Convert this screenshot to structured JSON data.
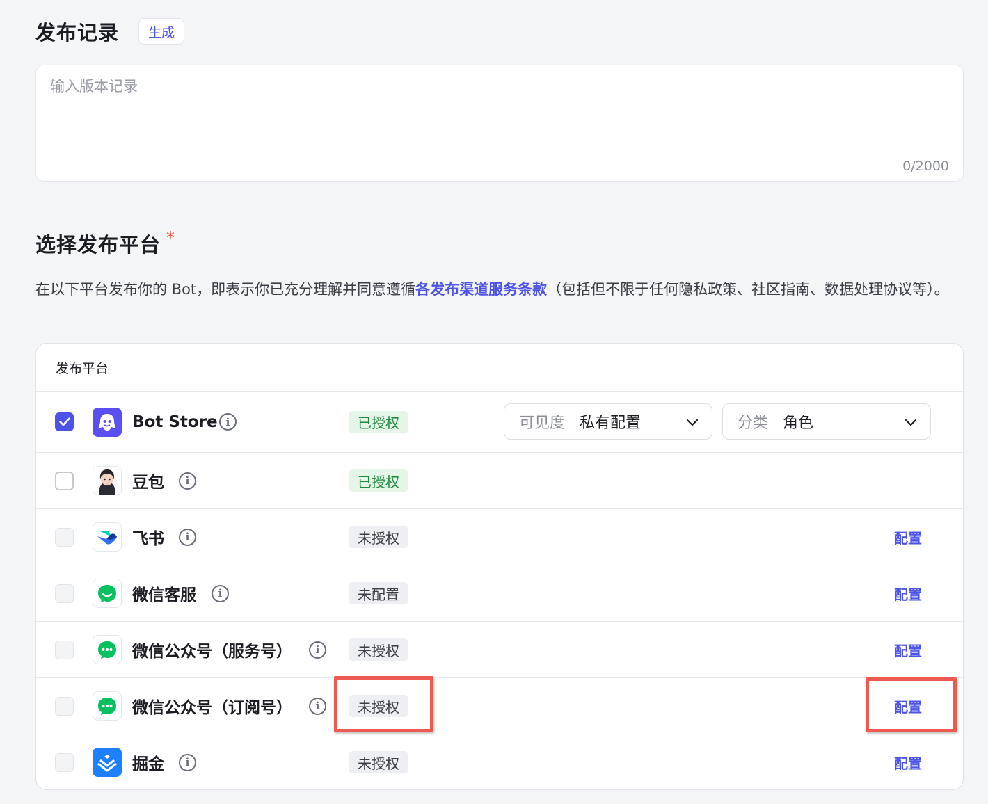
{
  "release": {
    "title": "发布记录",
    "generate_label": "生成",
    "placeholder": "输入版本记录",
    "counter": "0/2000"
  },
  "platform_section": {
    "title": "选择发布平台",
    "required_mark": "*",
    "desc_before": "在以下平台发布你的 Bot，即表示你已充分理解并同意遵循",
    "desc_link": "各发布渠道服务条款",
    "desc_after": "（包括但不限于任何隐私政策、社区指南、数据处理协议等）。"
  },
  "table": {
    "header": "发布平台",
    "rows": [
      {
        "name": "Bot Store",
        "status": "已授权",
        "status_kind": "ok",
        "checked": true,
        "enabled": true,
        "icon": "bot-store-icon",
        "info": "i"
      },
      {
        "name": "豆包",
        "status": "已授权",
        "status_kind": "ok",
        "checked": false,
        "enabled": true,
        "icon": "doubao-avatar-icon",
        "info": "i"
      },
      {
        "name": "飞书",
        "status": "未授权",
        "status_kind": "no",
        "checked": false,
        "enabled": false,
        "icon": "feishu-icon",
        "action": "配置",
        "info": "i"
      },
      {
        "name": "微信客服",
        "status": "未配置",
        "status_kind": "no",
        "checked": false,
        "enabled": false,
        "icon": "wechat-service-icon",
        "action": "配置",
        "info": "i"
      },
      {
        "name": "微信公众号（服务号）",
        "status": "未授权",
        "status_kind": "no",
        "checked": false,
        "enabled": false,
        "icon": "wechat-icon",
        "action": "配置",
        "info": "i"
      },
      {
        "name": "微信公众号（订阅号）",
        "status": "未授权",
        "status_kind": "no",
        "checked": false,
        "enabled": false,
        "icon": "wechat-icon",
        "action": "配置",
        "info": "i"
      },
      {
        "name": "掘金",
        "status": "未授权",
        "status_kind": "no",
        "checked": false,
        "enabled": false,
        "icon": "juejin-icon",
        "action": "配置",
        "info": "i"
      }
    ],
    "bot_store_selects": {
      "visibility_label": "可见度",
      "visibility_value": "私有配置",
      "category_label": "分类",
      "category_value": "角色"
    }
  },
  "colors": {
    "accent": "#4d53e8",
    "ok_bg": "#e5f6e9",
    "ok_text": "#1f8a3d",
    "highlight": "#ee5a50",
    "wechat": "#07c160"
  }
}
